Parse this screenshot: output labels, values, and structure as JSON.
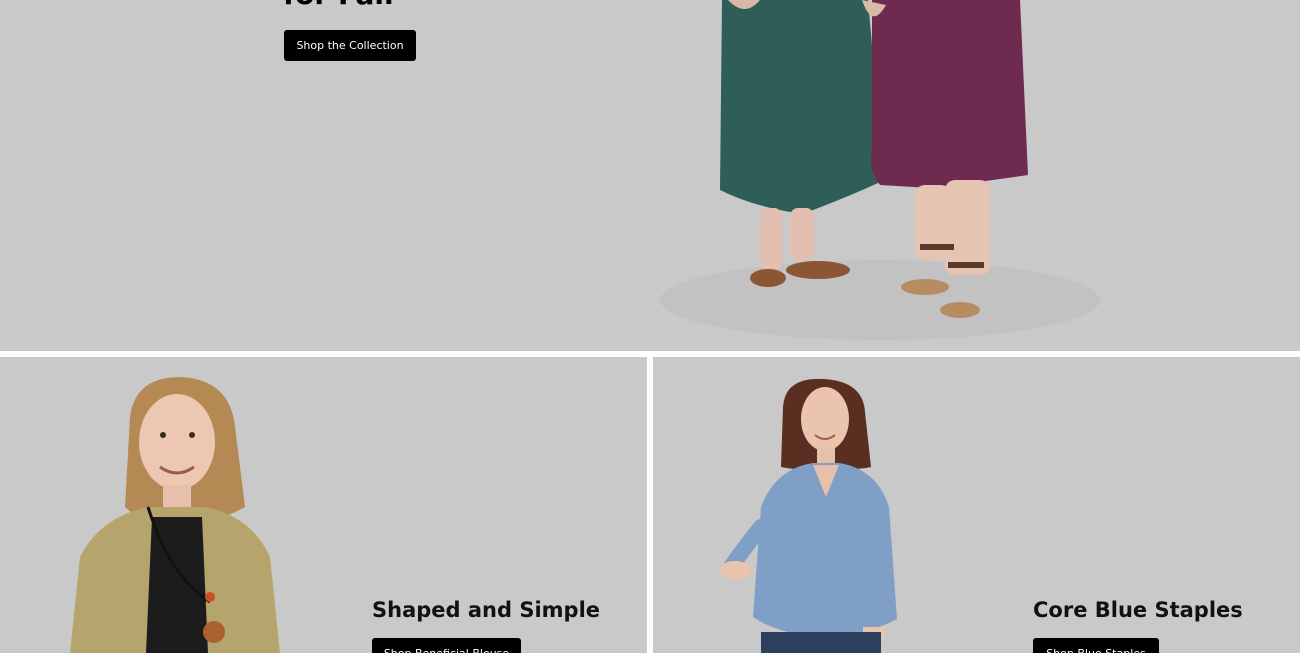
{
  "hero": {
    "title": "for Fall",
    "cta_label": "Shop the Collection"
  },
  "promos": [
    {
      "title": "Shaped and Simple",
      "cta_label": "Shop Beneficial Blouse"
    },
    {
      "title": "Core Blue Staples",
      "cta_label": "Shop Blue Staples"
    }
  ],
  "colors": {
    "background": "#c9c9c9",
    "button": "#000000",
    "button_text": "#ffffff",
    "dress_green": "#2f5e58",
    "dress_plum": "#6e2a4f",
    "cardigan": "#b5a56c",
    "blouse_blue": "#7f9fc6"
  }
}
